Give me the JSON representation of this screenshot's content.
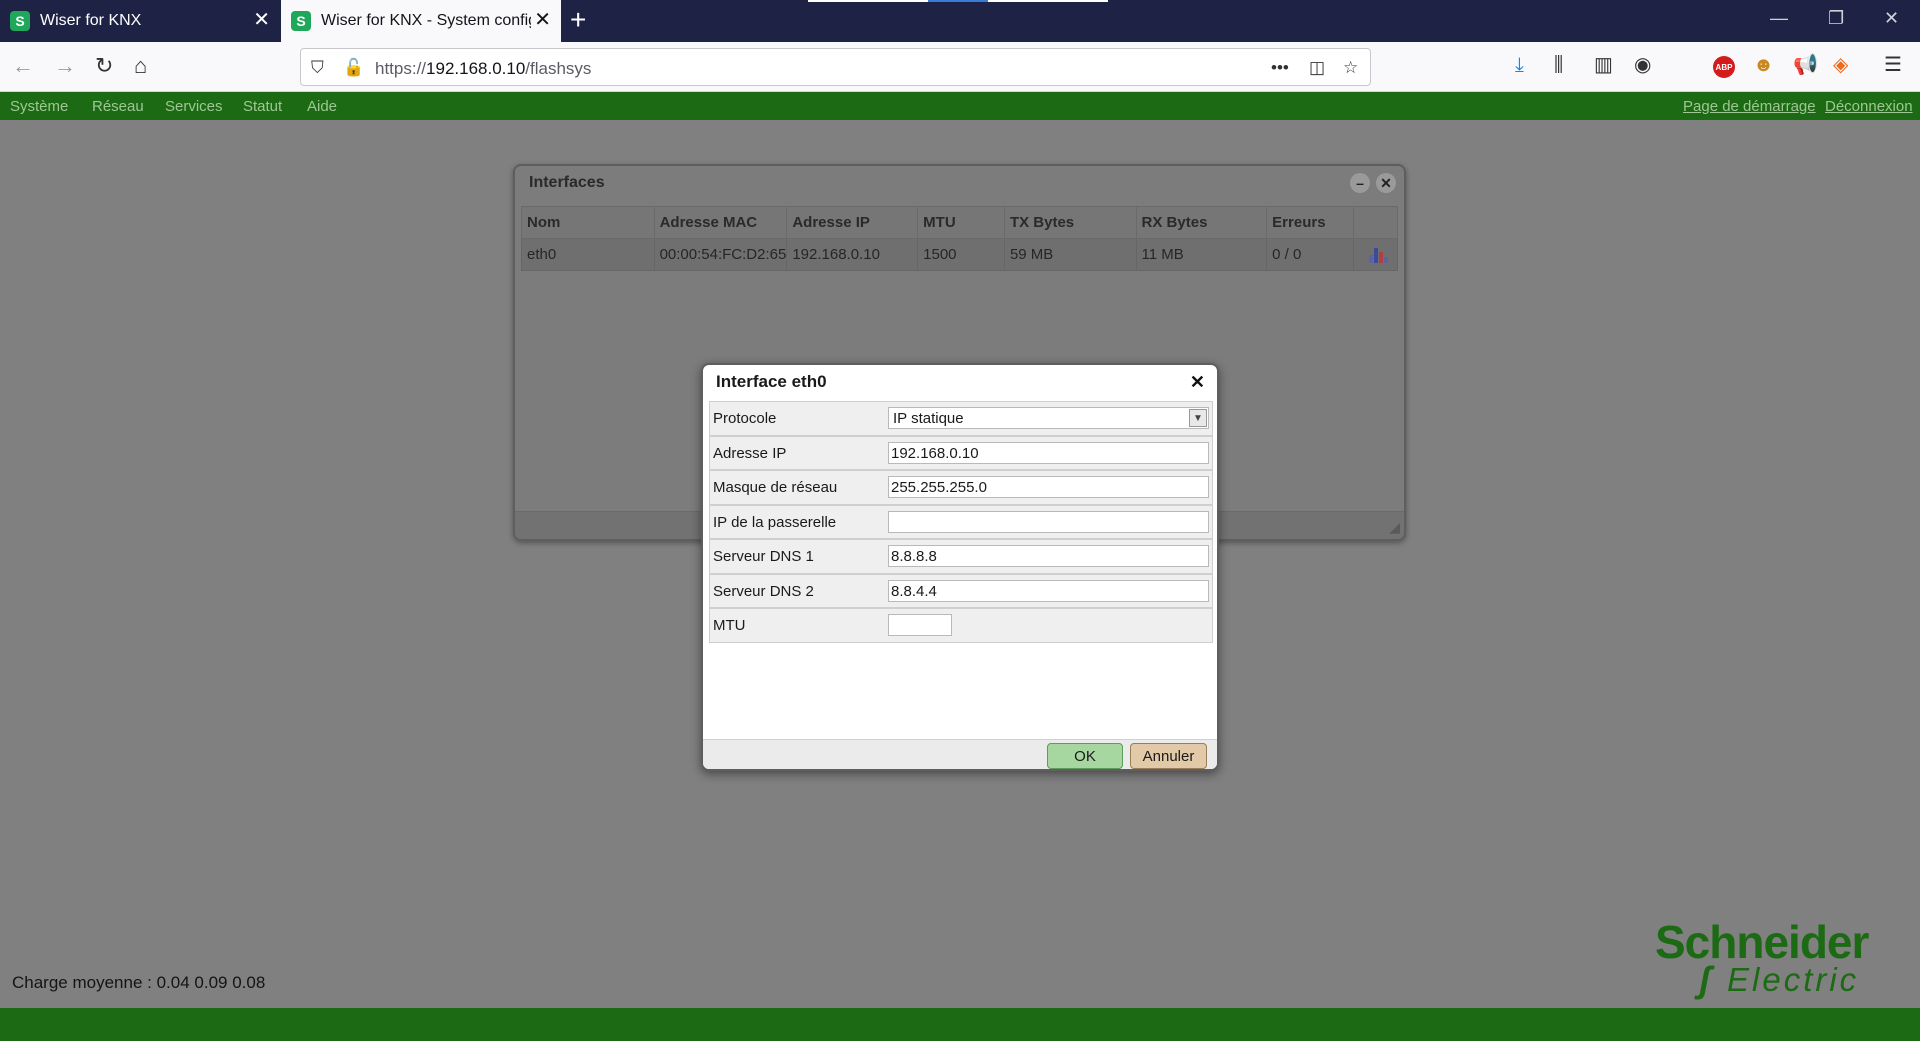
{
  "browser": {
    "tabs": [
      {
        "title": "Wiser for KNX"
      },
      {
        "title": "Wiser for KNX - System configuration"
      }
    ],
    "url_prefix": "https://",
    "url_host": "192.168.0.10",
    "url_path": "/flashsys"
  },
  "menu": {
    "items": [
      "Système",
      "Réseau",
      "Services",
      "Statut",
      "Aide"
    ],
    "right_links": [
      "Page de démarrage",
      "Déconnexion"
    ]
  },
  "interfaces_window": {
    "title": "Interfaces",
    "columns": [
      "Nom",
      "Adresse MAC",
      "Adresse IP",
      "MTU",
      "TX Bytes",
      "RX Bytes",
      "Erreurs"
    ],
    "rows": [
      {
        "nom": "eth0",
        "mac": "00:00:54:FC:D2:65",
        "ip": "192.168.0.10",
        "mtu": "1500",
        "tx": "59 MB",
        "rx": "11 MB",
        "erreurs": "0 / 0"
      }
    ]
  },
  "dialog": {
    "title": "Interface eth0",
    "fields": [
      {
        "label": "Protocole",
        "value": "IP statique"
      },
      {
        "label": "Adresse IP",
        "value": "192.168.0.10"
      },
      {
        "label": "Masque de réseau",
        "value": "255.255.255.0"
      },
      {
        "label": "IP de la passerelle",
        "value": ""
      },
      {
        "label": "Serveur DNS 1",
        "value": "8.8.8.8"
      },
      {
        "label": "Serveur DNS 2",
        "value": "8.8.4.4"
      },
      {
        "label": "MTU",
        "value": ""
      }
    ],
    "ok_label": "OK",
    "cancel_label": "Annuler"
  },
  "footer": {
    "load_average": "Charge moyenne : 0.04 0.09 0.08",
    "logo_line1": "Schneider",
    "logo_line2": "Electric"
  },
  "colors": {
    "brand_green": "#1c6a14",
    "ok_button": "#a7d7a1",
    "cancel_button": "#e2c9a7"
  }
}
